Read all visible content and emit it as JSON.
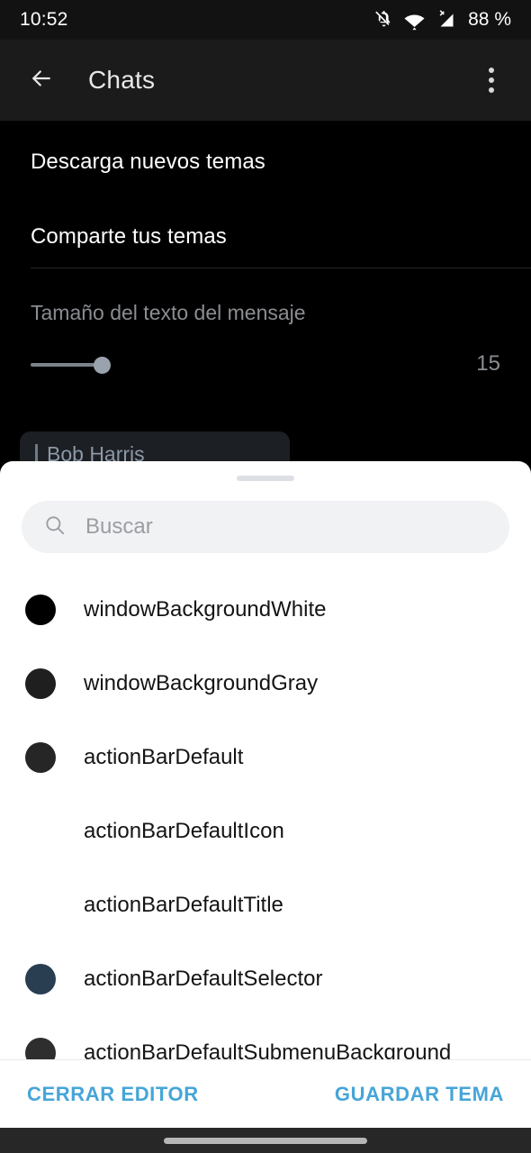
{
  "status_bar": {
    "time": "10:52",
    "battery": "88 %",
    "icons": [
      "notifications-off-icon",
      "wifi-icon",
      "signal-no-sim-icon"
    ]
  },
  "action_bar": {
    "back_icon": "arrow-back-icon",
    "title": "Chats",
    "overflow_icon": "more-vertical-icon"
  },
  "settings": {
    "download_themes": "Descarga nuevos temas",
    "share_themes": "Comparte tus temas",
    "text_size_label": "Tamaño del texto del mensaje",
    "text_size_value": "15",
    "preview_name": "Bob Harris"
  },
  "sheet": {
    "search": {
      "icon": "search-icon",
      "placeholder": "Buscar",
      "value": ""
    },
    "items": [
      {
        "label": "windowBackgroundWhite",
        "color": "#000000",
        "has_swatch": true
      },
      {
        "label": "windowBackgroundGray",
        "color": "#1f1f1f",
        "has_swatch": true
      },
      {
        "label": "actionBarDefault",
        "color": "#262626",
        "has_swatch": true
      },
      {
        "label": "actionBarDefaultIcon",
        "color": "",
        "has_swatch": false
      },
      {
        "label": "actionBarDefaultTitle",
        "color": "",
        "has_swatch": false
      },
      {
        "label": "actionBarDefaultSelector",
        "color": "#2a3e52",
        "has_swatch": true
      },
      {
        "label": "actionBarDefaultSubmenuBackground",
        "color": "#2e2e2e",
        "has_swatch": true
      }
    ],
    "footer": {
      "close_editor": "CERRAR EDITOR",
      "save_theme": "GUARDAR TEMA",
      "accent_color": "#46a5d8"
    }
  }
}
